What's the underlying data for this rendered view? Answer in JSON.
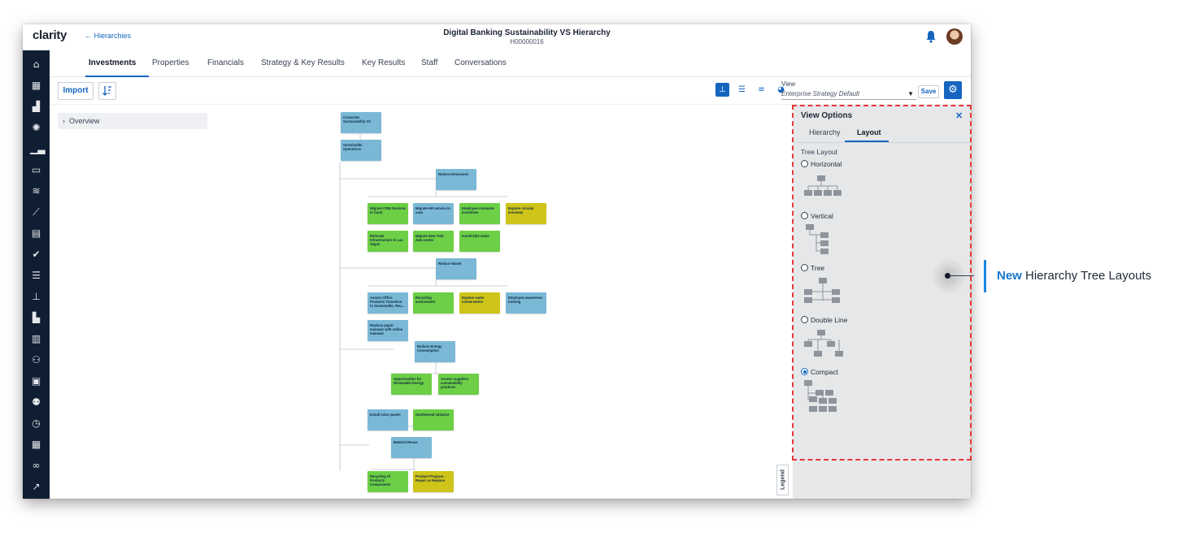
{
  "app": {
    "logo": "clarity",
    "back_link": "← Hierarchies",
    "title": "Digital Banking Sustainability VS Hierarchy",
    "subtitle": "H00000016"
  },
  "tabs": [
    "Investments",
    "Properties",
    "Financials",
    "Strategy & Key Results",
    "Key Results",
    "Staff",
    "Conversations"
  ],
  "toolbar": {
    "import_label": "Import",
    "view_label": "View",
    "view_value": "Enterprise Strategy Default",
    "save_label": "Save"
  },
  "overview_label": "Overview",
  "legend_label": "Legend",
  "tree_nodes": [
    "Corporate Sustainability VS",
    "Sustainable Operations",
    "Reduce Emissions",
    "Migrate CRM Services to SaaS",
    "Migrate HR service to saas",
    "Employee commute incentives",
    "Explore circular economy",
    "Relocate Infrastructure to Las Vegas",
    "Migrate New York data center",
    "Install bike racks",
    "Reduce Waste",
    "Assess Office Products Transition to Sustainable, Reu...",
    "Recycling assessment",
    "Explore water conservation",
    "Employee awareness training",
    "Replace paper manuals with online manuals",
    "Reduce Energy Consumption",
    "Opportunities for Renewable Energy",
    "Assess suppliers sustainability practices",
    "Install solar panels",
    "Geothermal initiative",
    "Material Reuse",
    "Recycling of Products Components",
    "Product Program - Repair vs Replace"
  ],
  "view_options": {
    "title": "View Options",
    "tabs": [
      "Hierarchy",
      "Layout"
    ],
    "section_label": "Tree Layout",
    "options": [
      "Horizontal",
      "Vertical",
      "Tree",
      "Double Line",
      "Compact"
    ],
    "selected": "Compact"
  },
  "callout": {
    "new": "New",
    "text": "Hierarchy Tree Layouts"
  },
  "colors": {
    "accent": "#1565c0",
    "sidebar": "#0f1e33",
    "node_blue": "#7ab8d6",
    "node_green": "#6ccf45",
    "node_yellow": "#cfc41a",
    "highlight": "#e53935"
  }
}
